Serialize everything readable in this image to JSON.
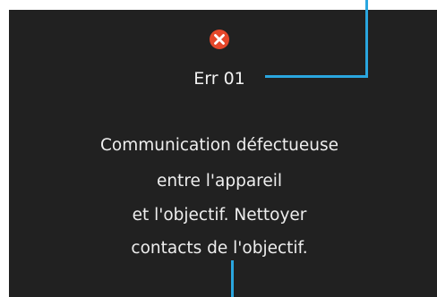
{
  "error": {
    "icon": "error-x-icon",
    "icon_color": "#e5472a",
    "code": "Err 01",
    "message_lines": [
      "Communication défectueuse",
      "entre l'appareil",
      "et l'objectif. Nettoyer",
      "contacts de l'objectif."
    ]
  },
  "colors": {
    "screen_background": "#212121",
    "text": "#eeeeee",
    "callout_line": "#2aa6df"
  }
}
